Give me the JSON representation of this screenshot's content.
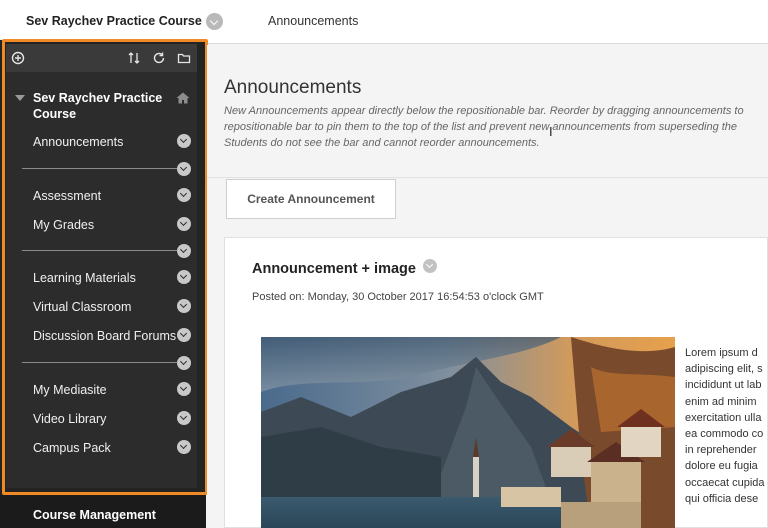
{
  "breadcrumb": {
    "course": "Sev Raychev Practice Course",
    "page": "Announcements"
  },
  "sidebar": {
    "course_title": "Sev Raychev Practice Course",
    "items": [
      {
        "label": "Announcements"
      },
      {
        "label": "Assessment"
      },
      {
        "label": "My Grades"
      },
      {
        "label": "Learning Materials"
      },
      {
        "label": "Virtual Classroom"
      },
      {
        "label": "Discussion Board Forums"
      },
      {
        "label": "My Mediasite"
      },
      {
        "label": "Video Library"
      },
      {
        "label": "Campus Pack"
      }
    ],
    "management_label": "Course Management"
  },
  "main": {
    "title": "Announcements",
    "description": [
      "New Announcements appear directly below the repositionable bar. Reorder by dragging announcements to",
      "repositionable bar to pin them to the top of the list and prevent new announcements from superseding the",
      "Students do not see the bar and cannot reorder announcements."
    ],
    "create_button": "Create Announcement"
  },
  "announcement": {
    "title": "Announcement + image",
    "posted": "Posted on: Monday, 30 October 2017 16:54:53 o'clock GMT",
    "body_lines": [
      "Lorem ipsum d",
      "adipiscing elit, s",
      "incididunt ut lab",
      "enim ad minim",
      "exercitation ulla",
      "ea commodo co",
      "in reprehender",
      "dolore eu fugia",
      "occaecat cupida",
      "qui officia dese"
    ]
  },
  "colors": {
    "sidebar_bg": "#2c2c2c",
    "highlight_frame": "#f08a24",
    "page_bg": "#f4f4f4"
  }
}
